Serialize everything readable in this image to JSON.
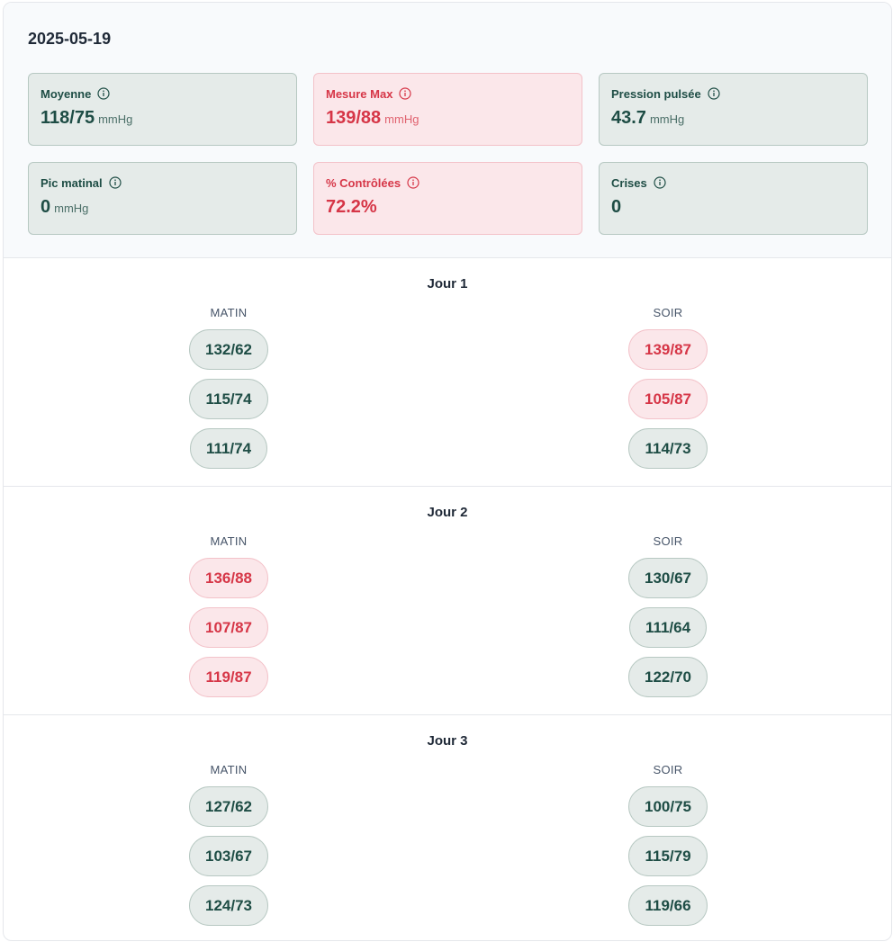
{
  "date": "2025-05-19",
  "unit": "mmHg",
  "colors": {
    "ok_text": "#1e4d45",
    "ok_bg": "#e5ebe9",
    "bad_text": "#d63647",
    "bad_bg": "#fbe7ea"
  },
  "stats": [
    {
      "label": "Moyenne",
      "value": "118/75",
      "unit": "mmHg",
      "status": "ok",
      "icon": "info-icon"
    },
    {
      "label": "Mesure Max",
      "value": "139/88",
      "unit": "mmHg",
      "status": "bad",
      "icon": "info-icon"
    },
    {
      "label": "Pression pulsée",
      "value": "43.7",
      "unit": "mmHg",
      "status": "ok",
      "icon": "info-icon"
    },
    {
      "label": "Pic matinal",
      "value": "0",
      "unit": "mmHg",
      "status": "ok",
      "icon": "info-icon"
    },
    {
      "label": "% Contrôlées",
      "value": "72.2%",
      "unit": "",
      "status": "bad",
      "icon": "info-icon"
    },
    {
      "label": "Crises",
      "value": "0",
      "unit": "",
      "status": "ok",
      "icon": "info-icon"
    }
  ],
  "labels": {
    "matin": "MATIN",
    "soir": "SOIR"
  },
  "days": [
    {
      "title": "Jour 1",
      "matin": [
        {
          "value": "132/62",
          "status": "ok"
        },
        {
          "value": "115/74",
          "status": "ok"
        },
        {
          "value": "111/74",
          "status": "ok"
        }
      ],
      "soir": [
        {
          "value": "139/87",
          "status": "bad"
        },
        {
          "value": "105/87",
          "status": "bad"
        },
        {
          "value": "114/73",
          "status": "ok"
        }
      ]
    },
    {
      "title": "Jour 2",
      "matin": [
        {
          "value": "136/88",
          "status": "bad"
        },
        {
          "value": "107/87",
          "status": "bad"
        },
        {
          "value": "119/87",
          "status": "bad"
        }
      ],
      "soir": [
        {
          "value": "130/67",
          "status": "ok"
        },
        {
          "value": "111/64",
          "status": "ok"
        },
        {
          "value": "122/70",
          "status": "ok"
        }
      ]
    },
    {
      "title": "Jour 3",
      "matin": [
        {
          "value": "127/62",
          "status": "ok"
        },
        {
          "value": "103/67",
          "status": "ok"
        },
        {
          "value": "124/73",
          "status": "ok"
        }
      ],
      "soir": [
        {
          "value": "100/75",
          "status": "ok"
        },
        {
          "value": "115/79",
          "status": "ok"
        },
        {
          "value": "119/66",
          "status": "ok"
        }
      ]
    }
  ]
}
